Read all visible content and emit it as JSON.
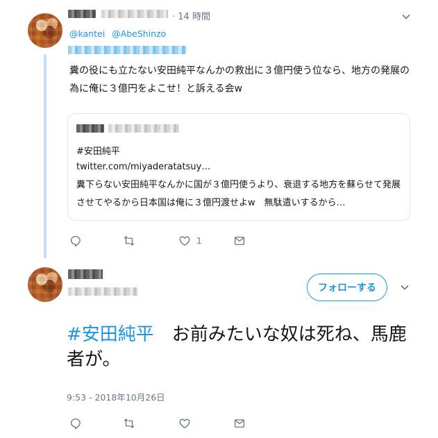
{
  "tweet1": {
    "time": "14 時間",
    "mentions": [
      "@kantei",
      "@AbeShinzo"
    ],
    "text": "糞の役にも立たない安田純平なんかの救出に３億円使う位なら、地方の発展の為に俺に３億円をよこせ！と訴える会w",
    "quote": {
      "hashtag": "#安田純平",
      "link": "twitter.com/miyaderatatsuy…",
      "text": "糞下らない安田純平なんかに国が３億円使うより、衰退する地方を蘇らせて発展させてやるから日本国は俺に３億円渡せよw　無駄遣いするから…"
    },
    "actions": {
      "like_count": "1"
    }
  },
  "tweet2": {
    "follow_label": "フォローする",
    "hashtag": "#安田純平",
    "text": "　お前みたいな奴は死ね、馬鹿者が。",
    "timestamp": "9:53 - 2018年10月26日"
  },
  "icons": {
    "reply": "reply-icon",
    "retweet": "retweet-icon",
    "like": "heart-icon",
    "dm": "envelope-icon",
    "more": "chevron-down-icon"
  },
  "colors": {
    "accent": "#1b95e0",
    "secondary_text": "#657786",
    "thread_line": "#c4dff4"
  }
}
